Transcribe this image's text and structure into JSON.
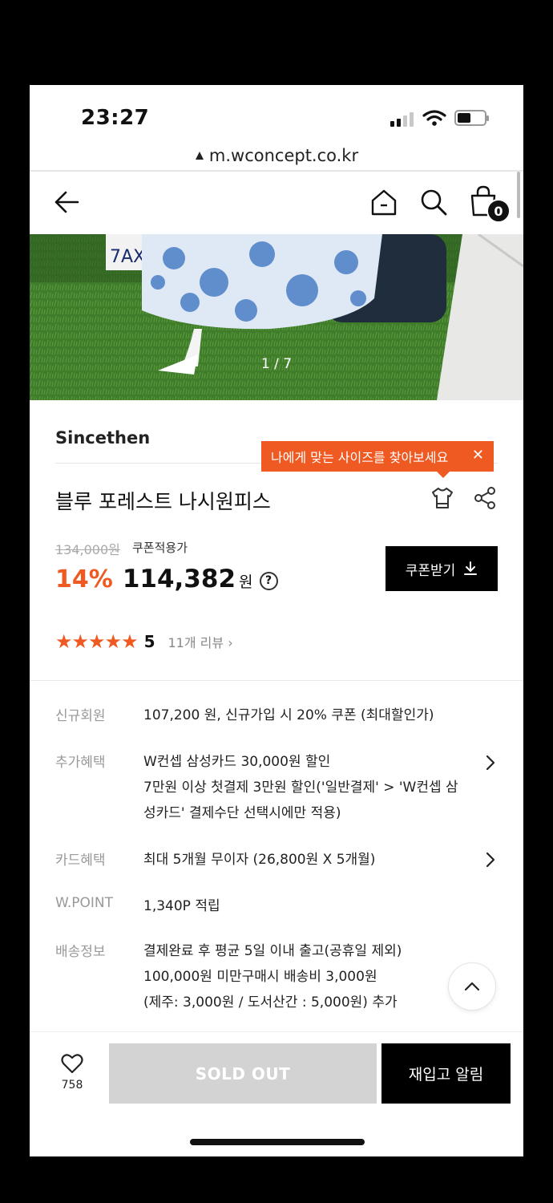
{
  "status_bar": {
    "time": "23:27"
  },
  "browser": {
    "url": "m.wconcept.co.kr"
  },
  "nav": {
    "cart_count": "0"
  },
  "image": {
    "counter": "1 / 7"
  },
  "product": {
    "brand": "Sincethen",
    "size_tip": "나에게 맞는 사이즈를 찾아보세요",
    "size_tip_close": "✕",
    "title": "블루 포레스트 나시원피스",
    "original_price": "134,000원",
    "coupon_note": "쿠폰적용가",
    "discount": "14%",
    "price": "114,382",
    "currency": "원",
    "help": "?",
    "coupon_button": "쿠폰받기",
    "rating": "5",
    "stars": "★★★★★",
    "review_count": "11개 리뷰 ›"
  },
  "benefits": [
    {
      "label": "신규회원",
      "lines": [
        "107,200 원, 신규가입 시 20% 쿠폰 (최대할인가)"
      ]
    },
    {
      "label": "추가혜택",
      "lines": [
        "W컨셉 삼성카드 30,000원 할인",
        "7만원 이상 첫결제 3만원 할인('일반결제' > 'W컨셉 삼",
        "성카드' 결제수단 선택시에만 적용)"
      ]
    },
    {
      "label": "카드혜택",
      "lines": [
        "최대 5개월 무이자 (26,800원 X 5개월)"
      ]
    },
    {
      "label": "W.POINT",
      "lines": [
        "1,340P 적립"
      ]
    },
    {
      "label": "배송정보",
      "lines": [
        "결제완료 후 평균 5일 이내 출고(공휴일 제외)",
        "100,000원 미만구매시 배송비 3,000원",
        "(제주: 3,000원 / 도서산간 : 5,000원) 추가"
      ]
    }
  ],
  "bottom_bar": {
    "wish_count": "758",
    "soldout_label": "SOLD OUT",
    "restock_label": "재입고 알림"
  },
  "colors": {
    "accent": "#ef5a23",
    "black": "#000000",
    "soldout": "#d3d3d3"
  }
}
